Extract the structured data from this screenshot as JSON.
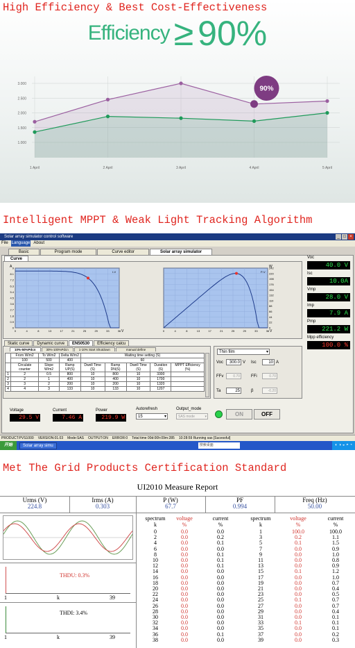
{
  "section1": {
    "title": "High Efficiency & Best Cost-Effectiveness",
    "efficiency_word": "Efficiency",
    "efficiency_symbol": "≥",
    "efficiency_value": "90%",
    "bubble": "90%"
  },
  "chart_data": {
    "type": "line",
    "categories": [
      "1 April",
      "2 April",
      "3 April",
      "4 April",
      "5 April"
    ],
    "y_ticks": [
      "1.000",
      "1.500",
      "2.000",
      "2.500",
      "3.000"
    ],
    "ylim": [
      1.0,
      3.0
    ],
    "grid": true,
    "series": [
      {
        "values": [
          1.7,
          2.45,
          3.0,
          2.3,
          2.4
        ],
        "color": "#9b5fa0"
      },
      {
        "values": [
          1.35,
          1.88,
          1.82,
          1.72,
          2.0
        ],
        "color": "#1f9a5a"
      }
    ],
    "annotation": {
      "text": "90%",
      "category": "4 April"
    }
  },
  "section2": {
    "title": "Intelligent MPPT & Weak Light Tracking Algorithm",
    "window_title": "Solar array simulator control software",
    "menu": [
      "File",
      "Language",
      "About"
    ],
    "main_tabs": [
      "Basic",
      "Program mode",
      "Curve editor",
      "Solar array simulator"
    ],
    "curve_tab": "Curve",
    "iv_label": "I-V",
    "pv_label": "P-V",
    "left_y_unit": "A",
    "right_y_unit": "W",
    "x_unit": "V",
    "left_y_ticks": [
      "0",
      "0.9",
      "1.8",
      "2.7",
      "3.6",
      "4.5",
      "5.4",
      "6.3",
      "7.2",
      "8.1",
      "9"
    ],
    "right_y_ticks": [
      "0",
      "22",
      "44",
      "66",
      "88",
      "110",
      "132",
      "154",
      "176",
      "198",
      "220",
      "242"
    ],
    "x_ticks": [
      "0",
      "4",
      "8",
      "13",
      "17",
      "21",
      "25",
      "29",
      "33",
      "36"
    ],
    "readouts": [
      {
        "label": "Voc",
        "value": "40.0 V"
      },
      {
        "label": "Isc",
        "value": "10.0A"
      },
      {
        "label": "Vmp",
        "value": "28.0 V"
      },
      {
        "label": "Imp",
        "value": "7.9 A"
      },
      {
        "label": "Pmp",
        "value": "221.2 W"
      },
      {
        "label": "Mpp efficiency",
        "value": "100.0 %"
      }
    ],
    "sub_tabs": [
      "Static curve",
      "Dynamic curve",
      "EN50530",
      "Efficiency calcu"
    ],
    "en_tabs": [
      "10%-50%Pdcn",
      "30%-100%Pdcn",
      "1-10% Start Shutdown",
      "manual define"
    ],
    "table_headers": [
      "From W/m2",
      "To W/m2",
      "Delta W/m2",
      "Waiting time setting (S)"
    ],
    "table_header_values": [
      "100",
      "500",
      "400",
      "60"
    ],
    "table_cols": [
      "Circulate counter",
      "Slope W/m2",
      "Ramp UP(S)",
      "Dwell Time (S)",
      "Ramp DN(S)",
      "Dwell Time (S)",
      "Duration (S)",
      "MPPT Efficiency (%)"
    ],
    "table_rows": [
      [
        "1",
        "2",
        "0.5",
        "800",
        "10",
        "800",
        "10",
        "3300",
        ""
      ],
      [
        "2",
        "2",
        "1",
        "400",
        "10",
        "400",
        "10",
        "1700",
        ""
      ],
      [
        "3",
        "3",
        "2",
        "200",
        "10",
        "200",
        "10",
        "1320",
        ""
      ],
      [
        "4",
        "4",
        "3",
        "133",
        "10",
        "133",
        "10",
        "1207",
        ""
      ]
    ],
    "film_select": "Thin film",
    "voc_label": "Voc",
    "voc_value": "300.0",
    "voc_unit": "V",
    "isc_label": "Isc",
    "isc_value": "10",
    "isc_unit": "A",
    "ffv_label": "FFv",
    "ffv_value": "0.70",
    "ffi_label": "FFi",
    "ffi_value": "0.70",
    "ta_label": "Ta",
    "ta_value": "25",
    "beta_label": "β",
    "beta_value": "-0.20",
    "voltage_label": "Voltage",
    "voltage_value": "29.5 V",
    "current_label": "Current",
    "current_value": "7.46 A",
    "power_label": "Power",
    "power_value": "219.9 W",
    "autorefresh_label": "Autorefresh",
    "autorefresh_value": "15",
    "output_mode_label": "Output_mode",
    "output_mode_value": "SAS mode",
    "on_label": "ON",
    "off_label": "OFF",
    "status": [
      "PRODUCT:PVS1000",
      "VERSION:01.03",
      "Mode:SAS",
      "OUTPUT:ON",
      "ERROR:0",
      "Total time 00d:00h:09m:285",
      "10:28:59 Running sas [Sucessful]"
    ],
    "start_label": "开始",
    "task_label": "Solar array simu",
    "search_placeholder": "搜索桌面"
  },
  "section3": {
    "title": "Met The Grid Products Certification Standard",
    "report_title": "UI2010 Measure Report",
    "params": [
      {
        "label": "Urms (V)",
        "value": "224.8"
      },
      {
        "label": "Irms (A)",
        "value": "0.303"
      },
      {
        "label": "P (W)",
        "value": "67.7"
      },
      {
        "label": "PF",
        "value": "0.994"
      },
      {
        "label": "Freq (Hz)",
        "value": "50.00"
      }
    ],
    "thdu": "THDU: 0.3%",
    "thdi": "THDI: 3.4%",
    "axis_start": "1",
    "axis_mid": "k",
    "axis_end": "39",
    "col_heads": [
      {
        "name": "spectrum",
        "unit": "k"
      },
      {
        "name": "voltage",
        "unit": "%"
      },
      {
        "name": "current",
        "unit": "%"
      },
      {
        "name": "spectrum",
        "unit": "k"
      },
      {
        "name": "voltage",
        "unit": "%"
      },
      {
        "name": "current",
        "unit": "%"
      }
    ],
    "even_k": [
      "0",
      "2",
      "4",
      "6",
      "8",
      "10",
      "12",
      "14",
      "16",
      "18",
      "20",
      "22",
      "24",
      "26",
      "28",
      "30",
      "32",
      "34",
      "36",
      "38"
    ],
    "even_v": [
      "0.0",
      "0.0",
      "0.0",
      "0.0",
      "0.0",
      "0.0",
      "0.0",
      "0.0",
      "0.0",
      "0.0",
      "0.0",
      "0.0",
      "0.0",
      "0.0",
      "0.0",
      "0.0",
      "0.0",
      "0.0",
      "0.0",
      "0.0"
    ],
    "even_i": [
      "0.0",
      "0.2",
      "0.1",
      "0.0",
      "0.1",
      "0.1",
      "0.1",
      "0.0",
      "0.0",
      "0.0",
      "0.0",
      "0.0",
      "0.0",
      "0.0",
      "0.0",
      "0.0",
      "0.0",
      "0.0",
      "0.1",
      "0.0"
    ],
    "odd_k": [
      "1",
      "3",
      "5",
      "7",
      "9",
      "11",
      "13",
      "15",
      "17",
      "19",
      "21",
      "23",
      "25",
      "27",
      "29",
      "31",
      "33",
      "35",
      "37",
      "39"
    ],
    "odd_v": [
      "100.0",
      "0.2",
      "0.1",
      "0.0",
      "0.0",
      "0.0",
      "0.0",
      "0.1",
      "0.0",
      "0.0",
      "0.0",
      "0.0",
      "0.1",
      "0.0",
      "0.0",
      "0.0",
      "0.1",
      "0.0",
      "0.0",
      "0.0"
    ],
    "odd_i": [
      "100.0",
      "1.1",
      "1.5",
      "0.9",
      "1.0",
      "0.8",
      "0.9",
      "1.2",
      "1.0",
      "0.7",
      "0.4",
      "0.5",
      "0.7",
      "0.7",
      "0.4",
      "0.1",
      "0.1",
      "0.1",
      "0.2",
      "0.3"
    ]
  }
}
